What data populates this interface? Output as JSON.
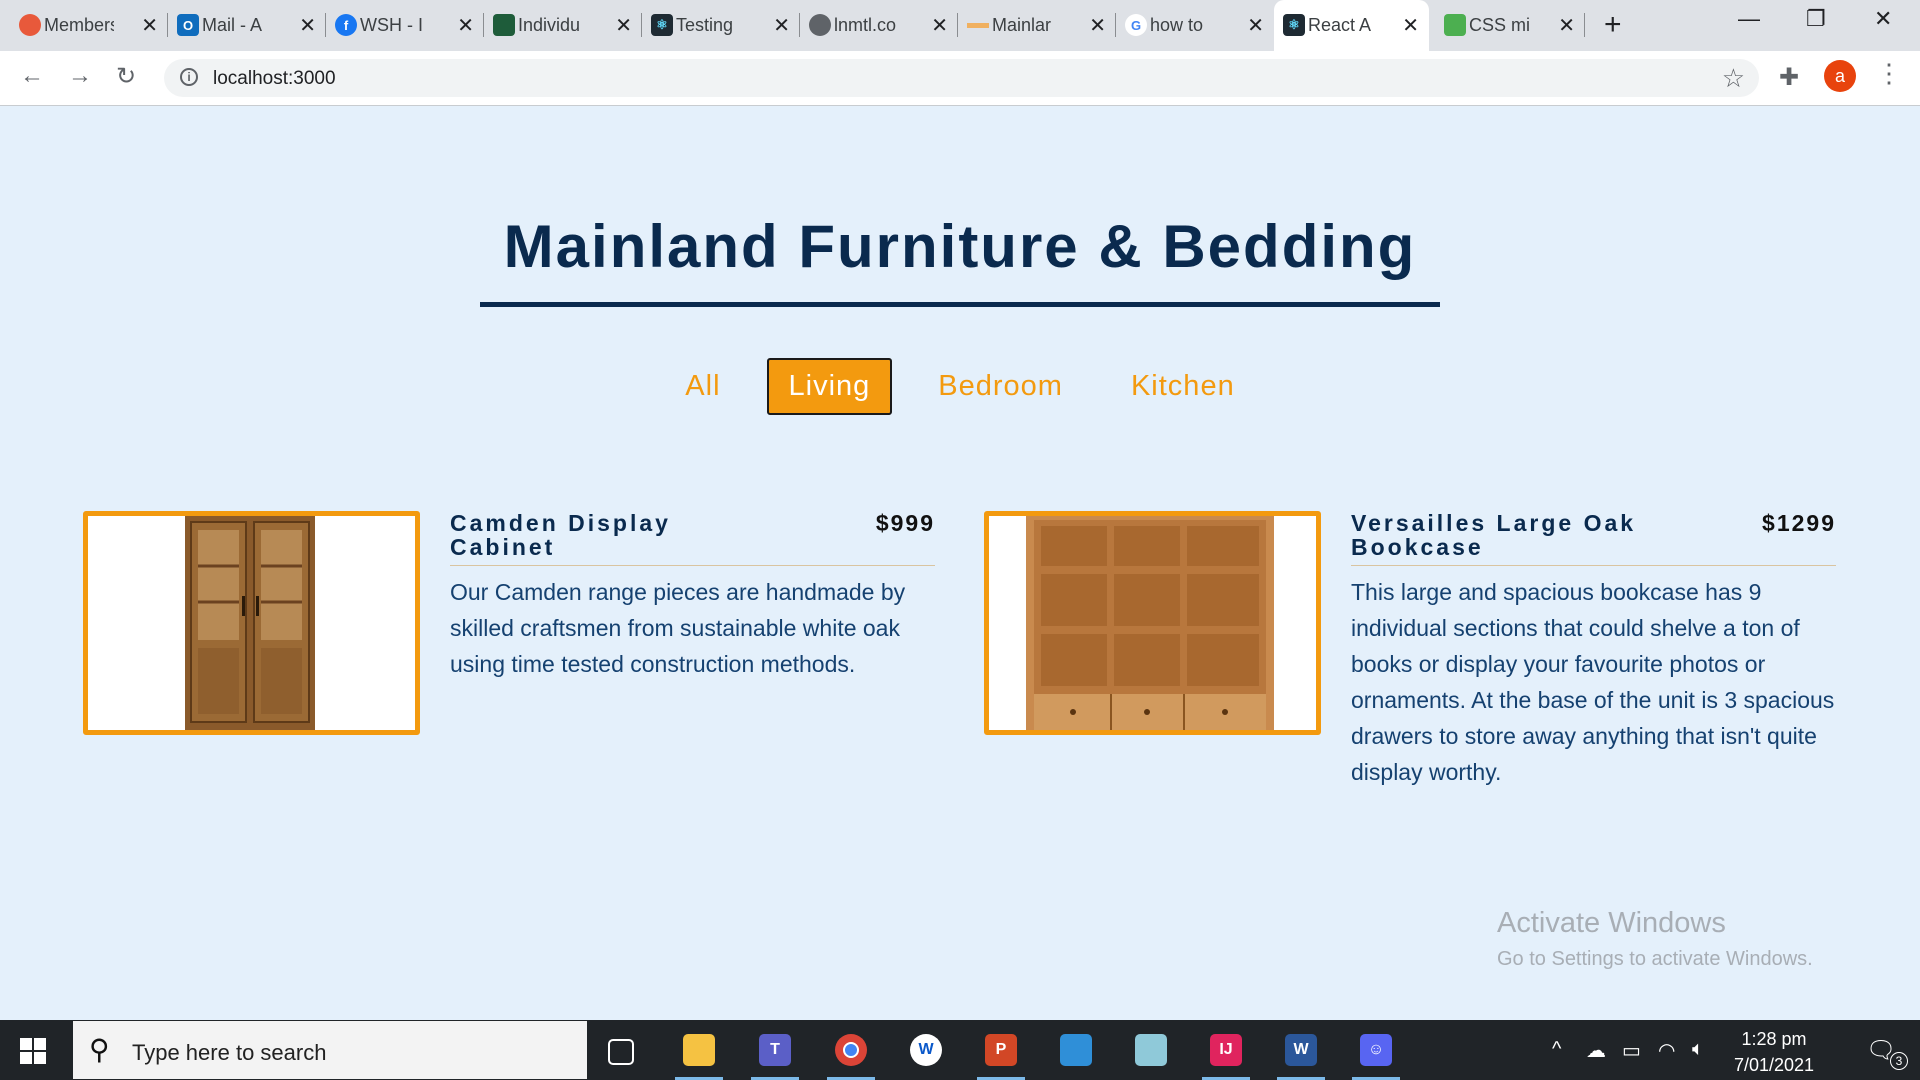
{
  "browser": {
    "tabs": [
      {
        "title": "Members",
        "icon": "octopus-icon",
        "color": "#e8593b"
      },
      {
        "title": "Mail - A",
        "icon": "outlook-icon",
        "color": "#0f6cbd"
      },
      {
        "title": "WSH - I",
        "icon": "facebook-icon",
        "color": "#1877f2"
      },
      {
        "title": "Individu",
        "icon": "shield-crest-icon",
        "color": "#1e5c3a"
      },
      {
        "title": "Testing",
        "icon": "react-icon",
        "color": "#1e2a33"
      },
      {
        "title": "lnmtl.co",
        "icon": "globe-icon",
        "color": "#5f6368"
      },
      {
        "title": "Mainlar",
        "icon": "furniture-logo-icon",
        "color": "#f0b060"
      },
      {
        "title": "how to",
        "icon": "google-icon",
        "color": "#4285f4"
      },
      {
        "title": "React A",
        "icon": "react-icon",
        "color": "#1e2a33",
        "active": true
      },
      {
        "title": "CSS mi",
        "icon": "css-minifier-icon",
        "color": "#4caf50"
      }
    ],
    "url": "localhost:3000",
    "profile_initial": "a",
    "accent": "#e8430d"
  },
  "page": {
    "title": "Mainland Furniture & Bedding",
    "filters": [
      "All",
      "Living",
      "Bedroom",
      "Kitchen"
    ],
    "active_filter": "Living",
    "items": [
      {
        "name": "Camden Display Cabinet",
        "price": "$999",
        "description": "Our Camden range pieces are handmade by skilled craftsmen from sustainable white oak using time tested construction methods."
      },
      {
        "name": "Versailles Large Oak Bookcase",
        "price": "$1299",
        "description": "This large and spacious bookcase has 9 individual sections that could shelve a ton of books or display your favourite photos or ornaments. At the base of the unit is 3 spacious drawers to store away anything that isn't quite display worthy."
      }
    ],
    "colors": {
      "background": "#e4f0fb",
      "accent": "#f39a0f",
      "heading": "#0a2a4e"
    }
  },
  "watermark": {
    "line1": "Activate Windows",
    "line2": "Go to Settings to activate Windows."
  },
  "taskbar": {
    "search_placeholder": "Type here to search",
    "time": "1:28 pm",
    "date": "7/01/2021",
    "notification_count": "3"
  }
}
